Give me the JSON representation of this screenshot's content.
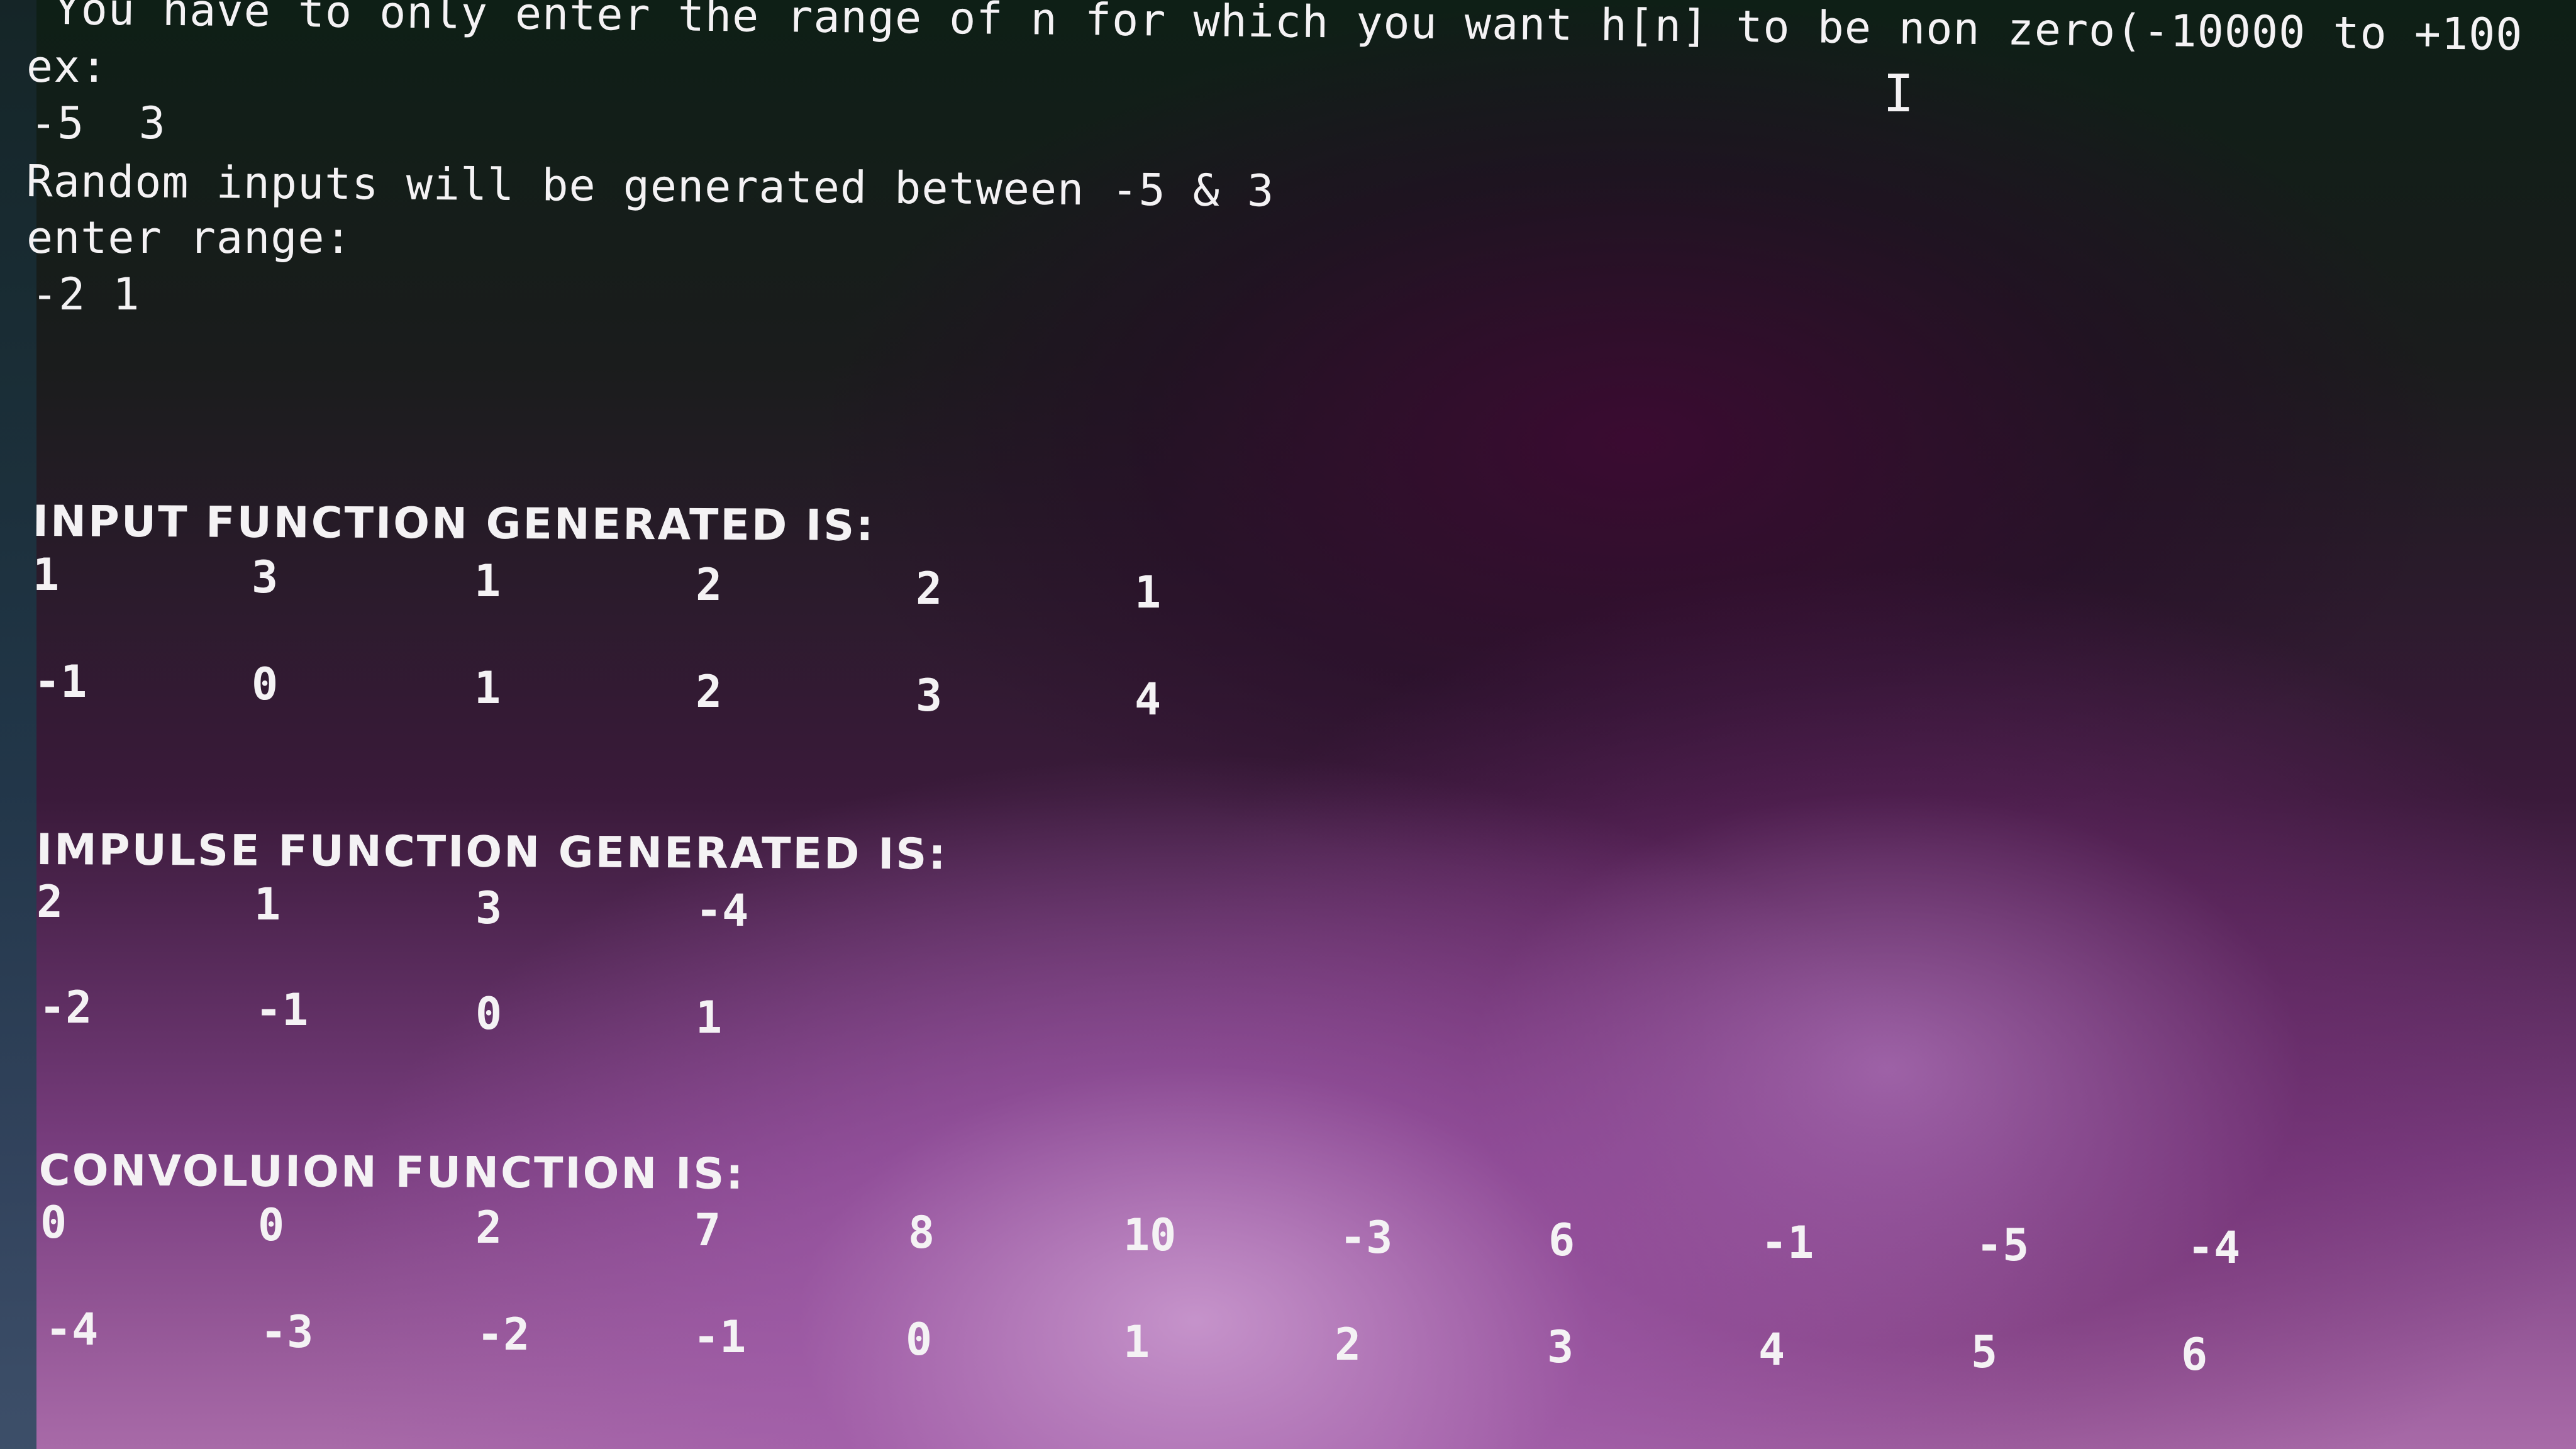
{
  "terminal": {
    "lines": {
      "instruction": "You have to only enter the range of n for which you want h[n] to be non zero(-10000 to +100",
      "ex_label": "ex:",
      "ex_values": "-5  3",
      "random_notice": "Random inputs will be generated between -5 & 3",
      "enter_range": "enter range:",
      "range_input": "-2 1"
    },
    "input_section": {
      "title": "INPUT FUNCTION GENERATED IS:",
      "values": [
        "1",
        "3",
        "1",
        "2",
        "2",
        "1"
      ],
      "indices": [
        "-1",
        "0",
        "1",
        "2",
        "3",
        "4"
      ]
    },
    "impulse_section": {
      "title": "IMPULSE FUNCTION GENERATED IS:",
      "values": [
        "2",
        "1",
        "3",
        "-4"
      ],
      "indices": [
        "-2",
        "-1",
        "0",
        "1"
      ]
    },
    "convolution_section": {
      "title": "CONVOLUION FUNCTION IS:",
      "values": [
        "0",
        "0",
        "2",
        "7",
        "8",
        "10",
        "-3",
        "6",
        "-1",
        "-5",
        "-4"
      ],
      "indices": [
        "-4",
        "-3",
        "-2",
        "-1",
        "0",
        "1",
        "2",
        "3",
        "4",
        "5",
        "6"
      ]
    },
    "cursor_glyph": "I"
  },
  "colors": {
    "text": "#f4f2f4",
    "background_top": "#0e1f16",
    "background_bottom": "#a86aa8"
  }
}
